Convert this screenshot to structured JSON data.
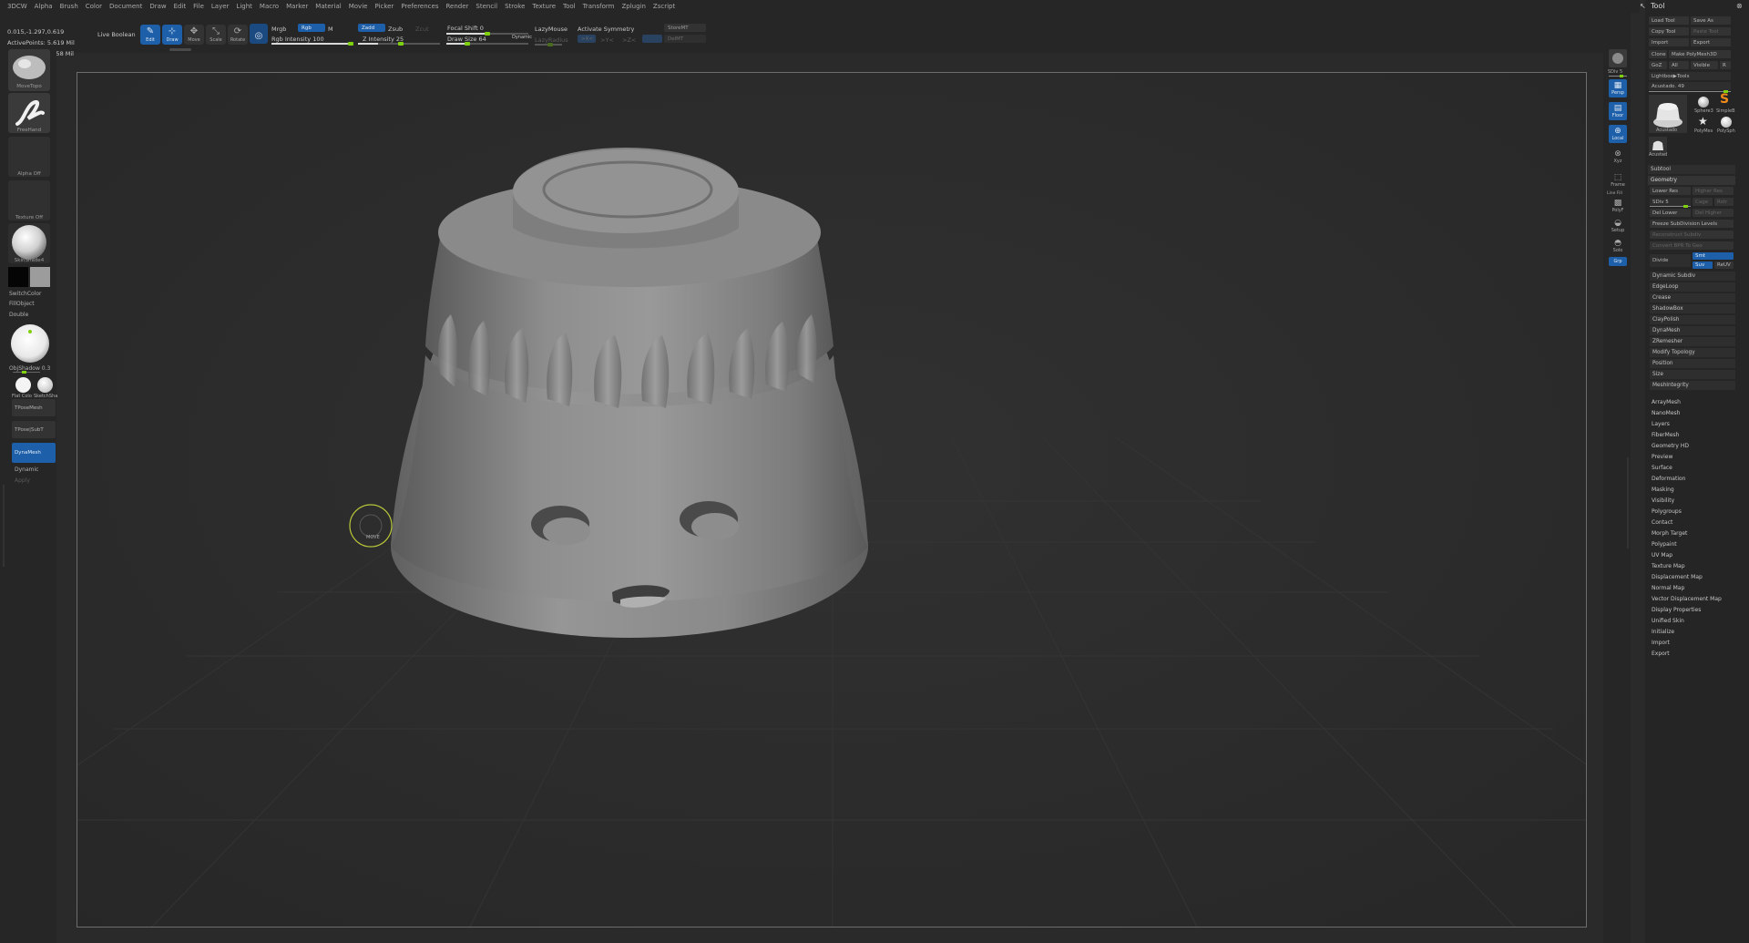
{
  "menu": [
    "3DCW",
    "Alpha",
    "Brush",
    "Color",
    "Document",
    "Draw",
    "Edit",
    "File",
    "Layer",
    "Light",
    "Macro",
    "Marker",
    "Material",
    "Movie",
    "Picker",
    "Preferences",
    "Render",
    "Stencil",
    "Stroke",
    "Texture",
    "Tool",
    "Transform",
    "Zplugin",
    "Zscript"
  ],
  "stats": {
    "coords": "0.015,-1.297,0.619",
    "active_points": "ActivePoints: 5.619 Mil",
    "total_points": "TotalPoints: 16.858 Mil"
  },
  "toolbar": {
    "live_boolean": "Live Boolean",
    "edit": "Edit",
    "draw": "Draw",
    "move": "Move",
    "scale": "Scale",
    "rotate": "Rotate",
    "mrgb": "Mrgb",
    "rgb": "Rgb",
    "m": "M",
    "rgb_intensity": "Rgb Intensity 100",
    "zadd": "Zadd",
    "zsub": "Zsub",
    "zcut": "Zcut",
    "z_intensity": "Z Intensity 25",
    "focal_shift": "Focal Shift 0",
    "draw_size": "Draw Size 64",
    "dynamic": "Dynamic",
    "lazymouse": "LazyMouse",
    "lazyradius": "LazyRadius",
    "activate_symmetry": "Activate Symmetry",
    "x": ">X<",
    "y": ">Y<",
    "z": ">Z<",
    "storemt": "StoreMT",
    "delmt": "DelMT"
  },
  "left_shelf": {
    "brush": "MoveTopo",
    "stroke": "FreeHand",
    "alpha": "Alpha Off",
    "texture": "Texture Off",
    "material": "SkinShade4",
    "switch_color": "SwitchColor",
    "fill_object": "FillObject",
    "double": "Double",
    "objshadow": "ObjShadow 0.3",
    "flat_color": "Flat Colo",
    "sketch": "SketchSha",
    "tposemesh": "TPoseMesh",
    "tpose_subt": "TPose|SubT",
    "dynamesh": "DynaMesh",
    "dynamic": "Dynamic",
    "apply": "Apply"
  },
  "right_shelf": {
    "sdiv": "SDiv 5",
    "persp": "Persp",
    "floor": "Floor",
    "local": "Local",
    "xyz": "Xyz",
    "frame": "Frame",
    "line_fill": "Line Fill",
    "polyf": "PolyF",
    "setup": "Setup",
    "solo": "Solo",
    "grp": "Grp"
  },
  "tool_panel": {
    "title": "Tool",
    "load_tool": "Load Tool",
    "save_as": "Save As",
    "copy_tool": "Copy Tool",
    "paste_tool": "Paste Tool",
    "import": "Import",
    "export": "Export",
    "clone": "Clone",
    "make_polymesh": "Make PolyMesh3D",
    "goz": "GoZ",
    "all": "All",
    "visible": "Visible",
    "r": "R",
    "lightbox_tools": "Lightbox▶Tools",
    "tool_name": "Acustado. 49",
    "thumb_main": "Acustado",
    "thumb_sphere": "Sphere3",
    "thumb_simple": "SimpleB",
    "thumb_polymesh": "PolyMes",
    "thumb_polysph": "PolySph",
    "thumb_small": "Acustad",
    "subtool": "Subtool",
    "geometry": "Geometry",
    "lower_res": "Lower Res",
    "higher_res": "Higher Res",
    "sdiv": "SDiv 5",
    "cage": "Cage",
    "rstr": "Rstr",
    "del_lower": "Del Lower",
    "del_higher": "Del Higher",
    "freeze": "Freeze SubDivision Levels",
    "reconstruct": "Reconstruct Subdiv",
    "convert_bpr": "Convert BPR To Geo",
    "divide": "Divide",
    "smt": "Smt",
    "suv": "Suv",
    "reuv": "ReUV",
    "geometry_items": [
      "Dynamic Subdiv",
      "EdgeLoop",
      "Crease",
      "ShadowBox",
      "ClayPolish",
      "DynaMesh",
      "ZRemesher",
      "Modify Topology",
      "Position",
      "Size",
      "MeshIntegrity"
    ],
    "sections": [
      "ArrayMesh",
      "NanoMesh",
      "Layers",
      "FiberMesh",
      "Geometry HD",
      "Preview",
      "Surface",
      "Deformation",
      "Masking",
      "Visibility",
      "Polygroups",
      "Contact",
      "Morph Target",
      "Polypaint",
      "UV Map",
      "Texture Map",
      "Displacement Map",
      "Normal Map",
      "Vector Displacement Map",
      "Display Properties",
      "Unified Skin",
      "Initialize",
      "Import",
      "Export"
    ]
  },
  "cursor_label": "MOVE",
  "colors": {
    "accent": "#1d5fa8",
    "slider_thumb": "#7fd10f",
    "background": "#2a2a2a"
  }
}
